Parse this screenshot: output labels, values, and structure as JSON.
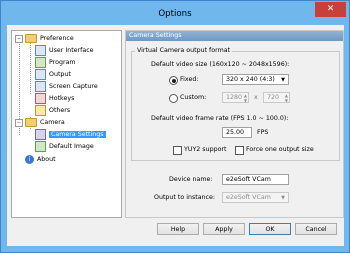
{
  "window": {
    "title": "Options",
    "close_glyph": "✕"
  },
  "tree": {
    "preference": "Preference",
    "user_interface": "User Interface",
    "program": "Program",
    "output": "Output",
    "screen_capture": "Screen Capture",
    "hotkeys": "Hotkeys",
    "others": "Others",
    "camera": "Camera",
    "camera_settings": "Camera Settings",
    "default_image": "Default Image",
    "about": "About",
    "expanded_glyph": "−",
    "about_icon_glyph": "i"
  },
  "panel": {
    "header": "Camera Settings",
    "group_title": "Virtual Camera output format",
    "video_size_label": "Default video size (160x120 ~ 2048x1596):",
    "fixed_label": "Fixed:",
    "fixed_value": "320 x 240 (4:3)",
    "custom_label": "Custom:",
    "custom_width": "1280",
    "custom_times": "x",
    "custom_height": "720",
    "frame_rate_label": "Default video frame rate (FPS 1.0 ~ 100.0):",
    "frame_rate_value": "25.00",
    "fps_unit": "FPS",
    "yuy2_label": "YUY2 support",
    "force_one_label": "Force one output size",
    "device_name_label": "Device name:",
    "device_name_value": "e2eSoft VCam",
    "output_instance_label": "Output to instance:",
    "output_instance_value": "e2eSoft VCam"
  },
  "buttons": {
    "help": "Help",
    "apply": "Apply",
    "ok": "OK",
    "cancel": "Cancel"
  }
}
